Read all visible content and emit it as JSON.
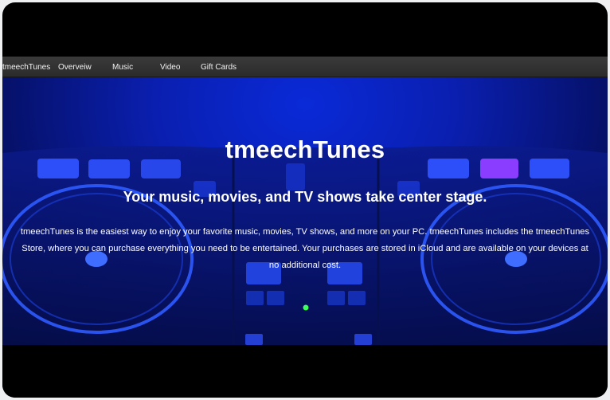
{
  "nav": {
    "brand": "tmeechTunes",
    "items": [
      {
        "label": "Overveiw"
      },
      {
        "label": "Music"
      },
      {
        "label": "Video"
      },
      {
        "label": "Gift Cards"
      }
    ]
  },
  "hero": {
    "title": "tmeechTunes",
    "subtitle": "Your music, movies, and TV shows take center stage.",
    "body": "tmeechTunes is the easiest way to enjoy your favorite music, movies, TV shows, and more on your PC. tmeechTunes includes the tmeechTunes Store, where you can purchase everything you need to be entertained. Your purchases are stored in iCloud and are available on your devices at no additional cost."
  },
  "colors": {
    "hero_blue": "#0a1fb0",
    "navbar": "#333333",
    "pad_purple": "#8a3cff",
    "led_green": "#3cff5a"
  },
  "icons": {
    "background": "dj-controller-background-image"
  }
}
